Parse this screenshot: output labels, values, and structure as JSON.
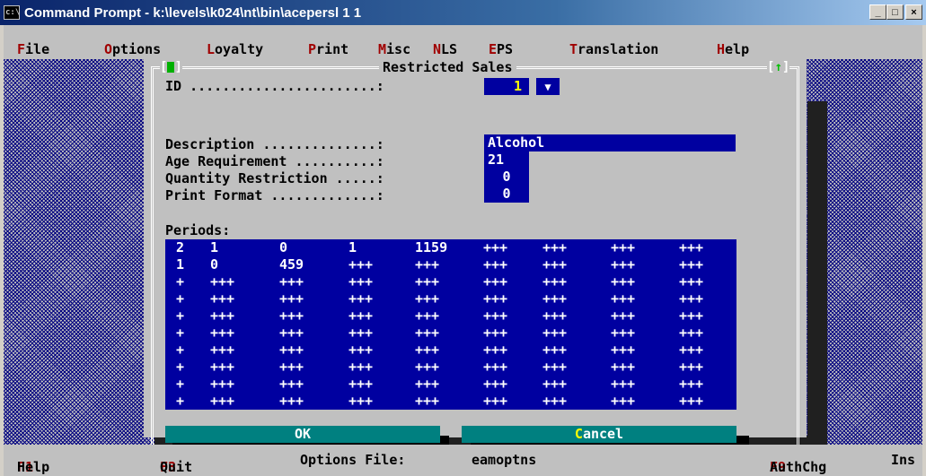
{
  "window": {
    "title": "Command Prompt - k:\\levels\\k024\\nt\\bin\\acepersl 1 1",
    "icon_text": "c:\\",
    "minimize": "_",
    "maximize": "□",
    "close": "×"
  },
  "menu": {
    "items": [
      {
        "hot": "F",
        "rest": "ile"
      },
      {
        "hot": "O",
        "rest": "ptions"
      },
      {
        "hot": "L",
        "rest": "oyalty"
      },
      {
        "hot": "P",
        "rest": "rint"
      },
      {
        "hot": "M",
        "rest": "isc"
      },
      {
        "hot": "N",
        "rest": "LS"
      },
      {
        "hot": "E",
        "rest": "PS"
      },
      {
        "hot": "T",
        "rest": "ranslation"
      },
      {
        "hot": "H",
        "rest": "elp"
      }
    ]
  },
  "dialog": {
    "title": "Restricted Sales",
    "left_indicator": "[",
    "left_indicator_close": "]",
    "right_indicator_open": "[",
    "right_indicator_arrow": "↑",
    "right_indicator_close": "]",
    "id_label": "ID .......................:",
    "id_value": "1",
    "id_dropdown": "▼",
    "description_label": "Description ..............:",
    "description_value": "Alcohol",
    "age_label": "Age Requirement ..........:",
    "age_value": "21",
    "quantity_label": "Quantity Restriction .....:",
    "quantity_value": "0",
    "print_label": "Print Format .............:",
    "print_value": "0",
    "periods_label": "Periods:",
    "periods_rows": [
      [
        "2",
        "1",
        "0",
        "1",
        "1159",
        "+++",
        "+++",
        "+++",
        "+++"
      ],
      [
        "1",
        "0",
        "459",
        "+++",
        "+++",
        "+++",
        "+++",
        "+++",
        "+++"
      ],
      [
        "+",
        "+++",
        "+++",
        "+++",
        "+++",
        "+++",
        "+++",
        "+++",
        "+++"
      ],
      [
        "+",
        "+++",
        "+++",
        "+++",
        "+++",
        "+++",
        "+++",
        "+++",
        "+++"
      ],
      [
        "+",
        "+++",
        "+++",
        "+++",
        "+++",
        "+++",
        "+++",
        "+++",
        "+++"
      ],
      [
        "+",
        "+++",
        "+++",
        "+++",
        "+++",
        "+++",
        "+++",
        "+++",
        "+++"
      ],
      [
        "+",
        "+++",
        "+++",
        "+++",
        "+++",
        "+++",
        "+++",
        "+++",
        "+++"
      ],
      [
        "+",
        "+++",
        "+++",
        "+++",
        "+++",
        "+++",
        "+++",
        "+++",
        "+++"
      ],
      [
        "+",
        "+++",
        "+++",
        "+++",
        "+++",
        "+++",
        "+++",
        "+++",
        "+++"
      ],
      [
        "+",
        "+++",
        "+++",
        "+++",
        "+++",
        "+++",
        "+++",
        "+++",
        "+++"
      ]
    ],
    "ok_label": "OK",
    "cancel_hot": "C",
    "cancel_rest": "ancel"
  },
  "status": {
    "f1_key": "F1",
    "f1_label": "Help",
    "f3_key": "F3",
    "f3_label": "Quit",
    "options_label": "Options File:",
    "options_value": "eamoptns",
    "f9_key": "F9",
    "f9_label": "AuthChg",
    "ins": "Ins"
  },
  "colors": {
    "field_bg": "#0000a0",
    "button_bg": "#008080",
    "hotkey": "#a00000",
    "title_start": "#0a246a"
  }
}
